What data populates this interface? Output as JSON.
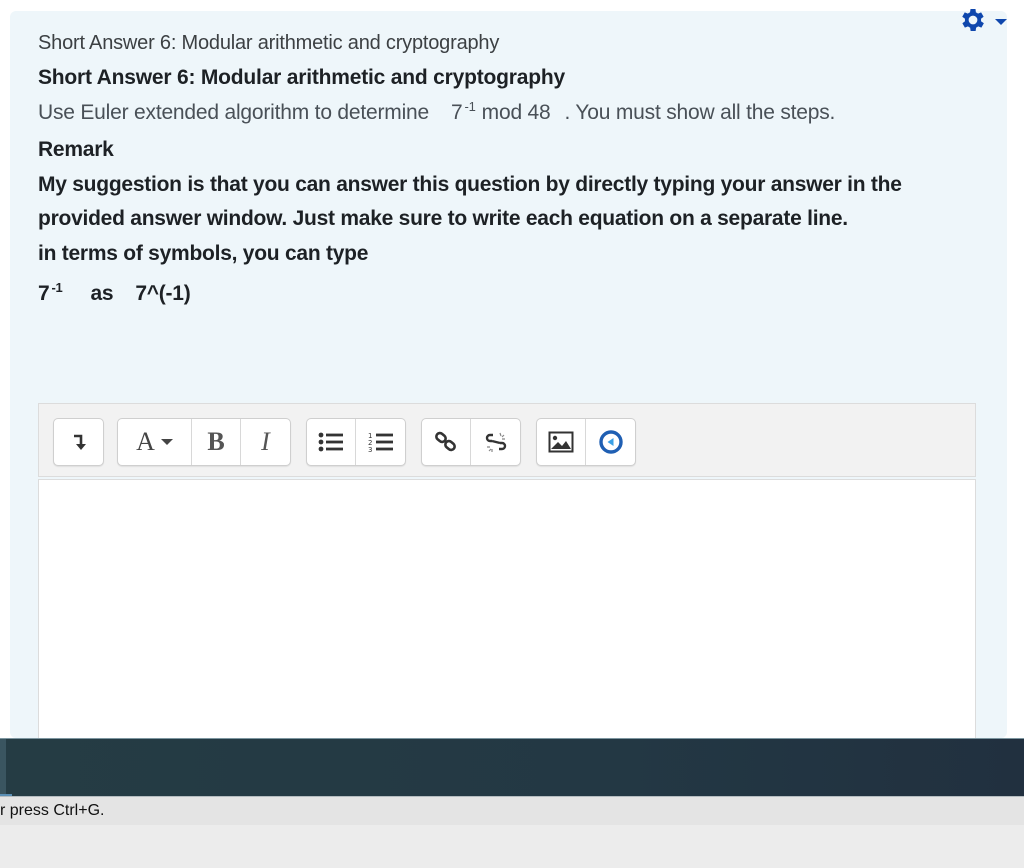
{
  "question": {
    "name": "Short Answer 6: Modular arithmetic and cryptography",
    "title": "Short Answer 6: Modular arithmetic and cryptography",
    "text_prefix": "Use Euler extended algorithm to determine",
    "math_base": "7",
    "math_exponent": "-1",
    "math_mod": "mod 48",
    "text_suffix": ". You must show all the steps.",
    "remark_heading": "Remark",
    "remark_paragraph": "My suggestion is that you can answer this question by directly typing your answer in the provided  answer window.  Just make sure to write each equation on a separate line.",
    "symbols_line": "in terms of symbols, you can type",
    "example_base": "7",
    "example_exponent": "-1",
    "example_as": "as",
    "example_typed": "7^(-1)"
  },
  "gear_menu": {
    "icon": "gear-icon",
    "color": "#0f47ad"
  },
  "editor": {
    "toolbar": [
      {
        "group": "collapse",
        "buttons": [
          {
            "name": "collapse-toolbar-button",
            "icon": "arrow-turn-down-icon",
            "label": "↴"
          }
        ]
      },
      {
        "group": "style",
        "buttons": [
          {
            "name": "paragraph-styles-button",
            "icon": "font-style-icon",
            "label": "A"
          },
          {
            "name": "bold-button",
            "icon": "bold-icon",
            "label": "B"
          },
          {
            "name": "italic-button",
            "icon": "italic-icon",
            "label": "I"
          }
        ]
      },
      {
        "group": "list",
        "buttons": [
          {
            "name": "unordered-list-button",
            "icon": "bulleted-list-icon"
          },
          {
            "name": "ordered-list-button",
            "icon": "numbered-list-icon"
          }
        ]
      },
      {
        "group": "links",
        "buttons": [
          {
            "name": "link-button",
            "icon": "link-icon"
          },
          {
            "name": "unlink-button",
            "icon": "unlink-icon"
          }
        ]
      },
      {
        "group": "files",
        "buttons": [
          {
            "name": "insert-image-button",
            "icon": "image-icon"
          },
          {
            "name": "media-button",
            "icon": "media-play-icon",
            "color": "#1177d1"
          }
        ]
      }
    ],
    "content": ""
  },
  "hint_bar": {
    "text": "r press Ctrl+G."
  },
  "colors": {
    "panel_bg": "#eef6fa",
    "accent": "#0f47ad",
    "dark_bar": "#243944"
  }
}
